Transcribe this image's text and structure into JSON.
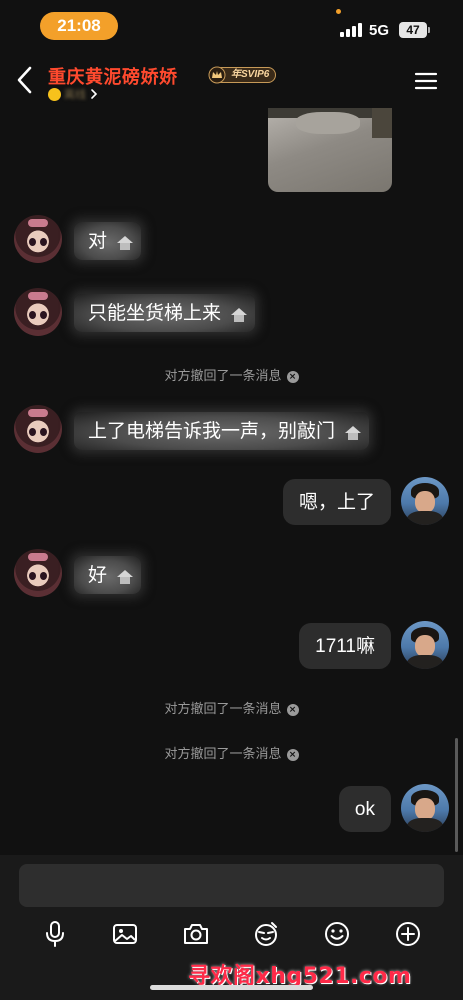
{
  "status_bar": {
    "time": "21:08",
    "network": "5G",
    "battery": "47"
  },
  "header": {
    "title": "重庆黄泥磅娇娇",
    "vip_label": "年SVIP6",
    "status_text": "离线"
  },
  "messages": [
    {
      "type": "image",
      "from": "contact"
    },
    {
      "type": "text",
      "from": "contact",
      "text": "对"
    },
    {
      "type": "text",
      "from": "contact",
      "text": "只能坐货梯上来"
    },
    {
      "type": "system",
      "text": "对方撤回了一条消息"
    },
    {
      "type": "text",
      "from": "contact",
      "text": "上了电梯告诉我一声，别敲门"
    },
    {
      "type": "text",
      "from": "me",
      "text": "嗯，上了"
    },
    {
      "type": "text",
      "from": "contact",
      "text": "好"
    },
    {
      "type": "text",
      "from": "me",
      "text": "1711嘛"
    },
    {
      "type": "system",
      "text": "对方撤回了一条消息"
    },
    {
      "type": "system",
      "text": "对方撤回了一条消息"
    },
    {
      "type": "text",
      "from": "me",
      "text": "ok"
    }
  ],
  "toolbar": [
    "microphone-icon",
    "image-icon",
    "camera-icon",
    "sticker-icon",
    "emoji-icon",
    "plus-icon"
  ],
  "watermark": "寻欢阁xhg521.com",
  "colors": {
    "accent": "#f3a02a",
    "title": "#ff4a2e",
    "background": "#111111",
    "bubble_out": "#2d2d2d"
  }
}
